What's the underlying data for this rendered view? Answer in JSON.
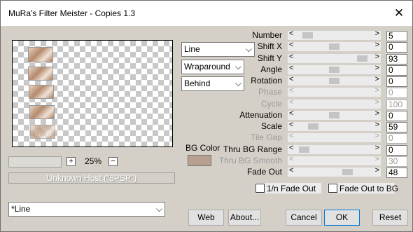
{
  "window": {
    "title": "MuRa's Filter Meister - Copies 1.3",
    "close_glyph": "✕"
  },
  "preview": {
    "zoom": "25%",
    "zoom_in": "+",
    "zoom_out": "−",
    "host": "Unknown Host (\"8PSP\")"
  },
  "dropdowns": {
    "mode": "Line",
    "wrap": "Wraparound",
    "order": "Behind",
    "preset": "*Line"
  },
  "bg_color": {
    "label": "BG Color",
    "value": "#b7a08f"
  },
  "params": [
    {
      "label": "Number",
      "value": "5",
      "enabled": true,
      "fraction": 0.1
    },
    {
      "label": "Shift X",
      "value": "0",
      "enabled": true,
      "fraction": 0.5
    },
    {
      "label": "Shift Y",
      "value": "93",
      "enabled": true,
      "fraction": 0.93
    },
    {
      "label": "Angle",
      "value": "0",
      "enabled": true,
      "fraction": 0.5
    },
    {
      "label": "Rotation",
      "value": "0",
      "enabled": true,
      "fraction": 0.5
    },
    {
      "label": "Phase",
      "value": "0",
      "enabled": false,
      "fraction": 0.0
    },
    {
      "label": "Cycle",
      "value": "100",
      "enabled": false,
      "fraction": 1.0
    },
    {
      "label": "Attenuation",
      "value": "0",
      "enabled": true,
      "fraction": 0.5
    },
    {
      "label": "Scale",
      "value": "59",
      "enabled": true,
      "fraction": 0.18
    },
    {
      "label": "Tile Gap",
      "value": "0",
      "enabled": false,
      "fraction": 0.0
    },
    {
      "label": "Thru BG Range",
      "value": "0",
      "enabled": true,
      "fraction": 0.04
    },
    {
      "label": "Thru BG Smooth",
      "value": "30",
      "enabled": false,
      "fraction": 0.3
    },
    {
      "label": "Fade Out",
      "value": "48",
      "enabled": true,
      "fraction": 0.7
    }
  ],
  "checkboxes": [
    {
      "label": "1/n Fade Out",
      "checked": false
    },
    {
      "label": "Fade Out to BG",
      "checked": false
    }
  ],
  "buttons": {
    "web": "Web",
    "about": "About...",
    "cancel": "Cancel",
    "ok": "OK",
    "reset": "Reset"
  }
}
